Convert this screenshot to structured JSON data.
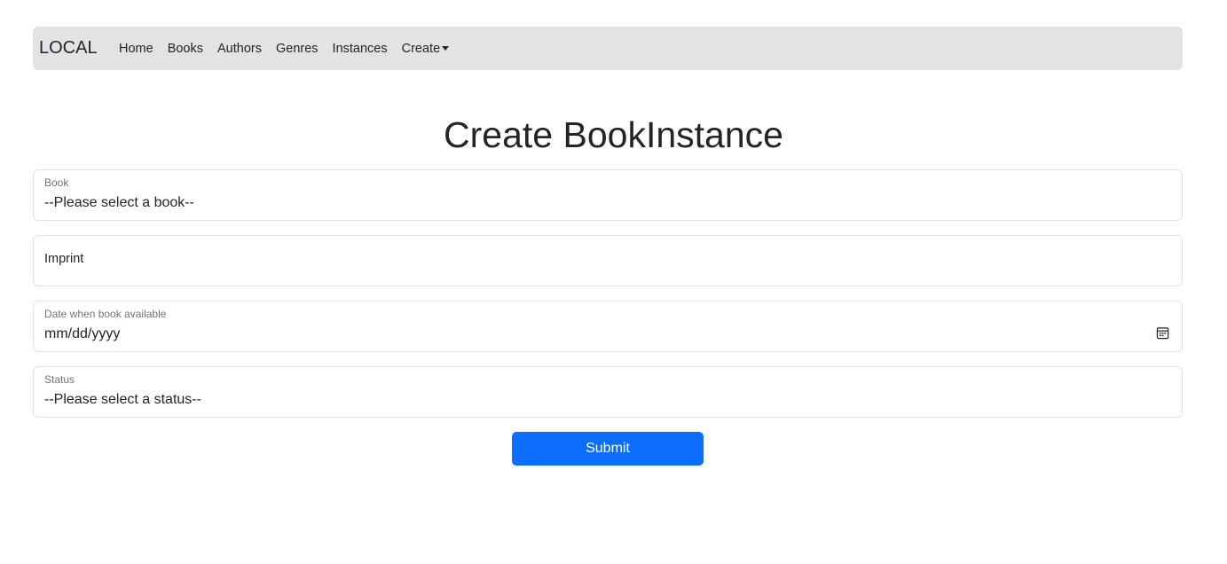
{
  "navbar": {
    "brand": "LOCAL",
    "links": [
      "Home",
      "Books",
      "Authors",
      "Genres",
      "Instances"
    ],
    "dropdown_label": "Create"
  },
  "page": {
    "title": "Create BookInstance"
  },
  "form": {
    "book": {
      "label": "Book",
      "value": "--Please select a book--"
    },
    "imprint": {
      "label": "Imprint",
      "value": ""
    },
    "due_back": {
      "label": "Date when book available",
      "placeholder": "mm/dd/yyyy",
      "icon": "calendar-icon"
    },
    "status": {
      "label": "Status",
      "value": "--Please select a status--"
    },
    "submit_label": "Submit"
  },
  "colors": {
    "navbar_bg": "#e2e3e5",
    "primary": "#0d6efd",
    "text": "#212529",
    "muted": "#6c757d",
    "border": "#dee2e6"
  }
}
